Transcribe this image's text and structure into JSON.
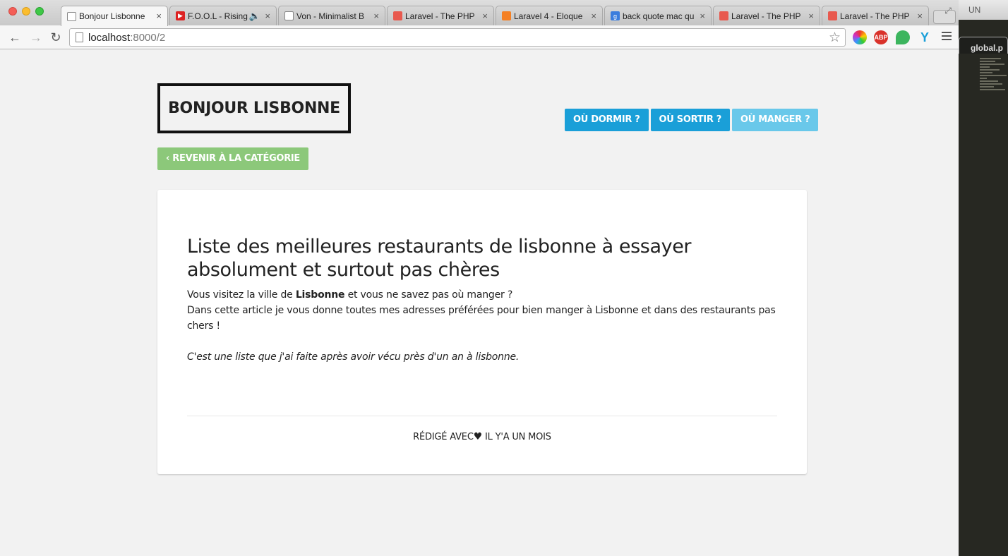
{
  "browser": {
    "tabs": [
      {
        "title": "Bonjour Lisbonne",
        "active": true,
        "icon": "page-icon"
      },
      {
        "title": "F.O.O.L - Rising",
        "icon": "youtube-icon",
        "audio": true
      },
      {
        "title": "Von - Minimalist B",
        "icon": "page-icon"
      },
      {
        "title": "Laravel - The PHP",
        "icon": "laravel-icon"
      },
      {
        "title": "Laravel 4 - Eloque",
        "icon": "stackoverflow-icon"
      },
      {
        "title": "back quote mac qu",
        "icon": "google-icon"
      },
      {
        "title": "Laravel - The PHP",
        "icon": "laravel-icon"
      },
      {
        "title": "Laravel - The PHP",
        "icon": "laravel-icon"
      }
    ],
    "url": {
      "host": "localhost",
      "port": ":8000/2"
    },
    "extensions": {
      "abp": "ABP"
    }
  },
  "editor": {
    "top_label": "UN",
    "tab_label": "global.p"
  },
  "site": {
    "logo": "BONJOUR LISBONNE",
    "nav": [
      "OÙ DORMIR ?",
      "OÙ SORTIR ?",
      "OÙ MANGER ?"
    ],
    "back_button": "‹ REVENIR À LA CATÉGORIE"
  },
  "article": {
    "title": "Liste des meilleures restaurants de lisbonne à essayer absolument et surtout pas chères",
    "intro_before": "Vous visitez la ville de ",
    "intro_bold": "Lisbonne",
    "intro_after": " et vous ne savez pas où manger ?",
    "line2": "Dans cette article je vous donne toutes mes adresses préférées pour bien manger à Lisbonne et dans des restaurants pas chers !",
    "italic": "C'est une liste que j'ai faite après avoir vécu près d'un an à lisbonne.",
    "footer_before": "RÉDIGÉ AVEC",
    "footer_heart": "♥",
    "footer_after": "IL Y'A UN MOIS"
  },
  "colors": {
    "nav_blue": "#1a9fd8",
    "nav_light_blue": "#69c8ea",
    "back_green": "#8cc87a"
  }
}
